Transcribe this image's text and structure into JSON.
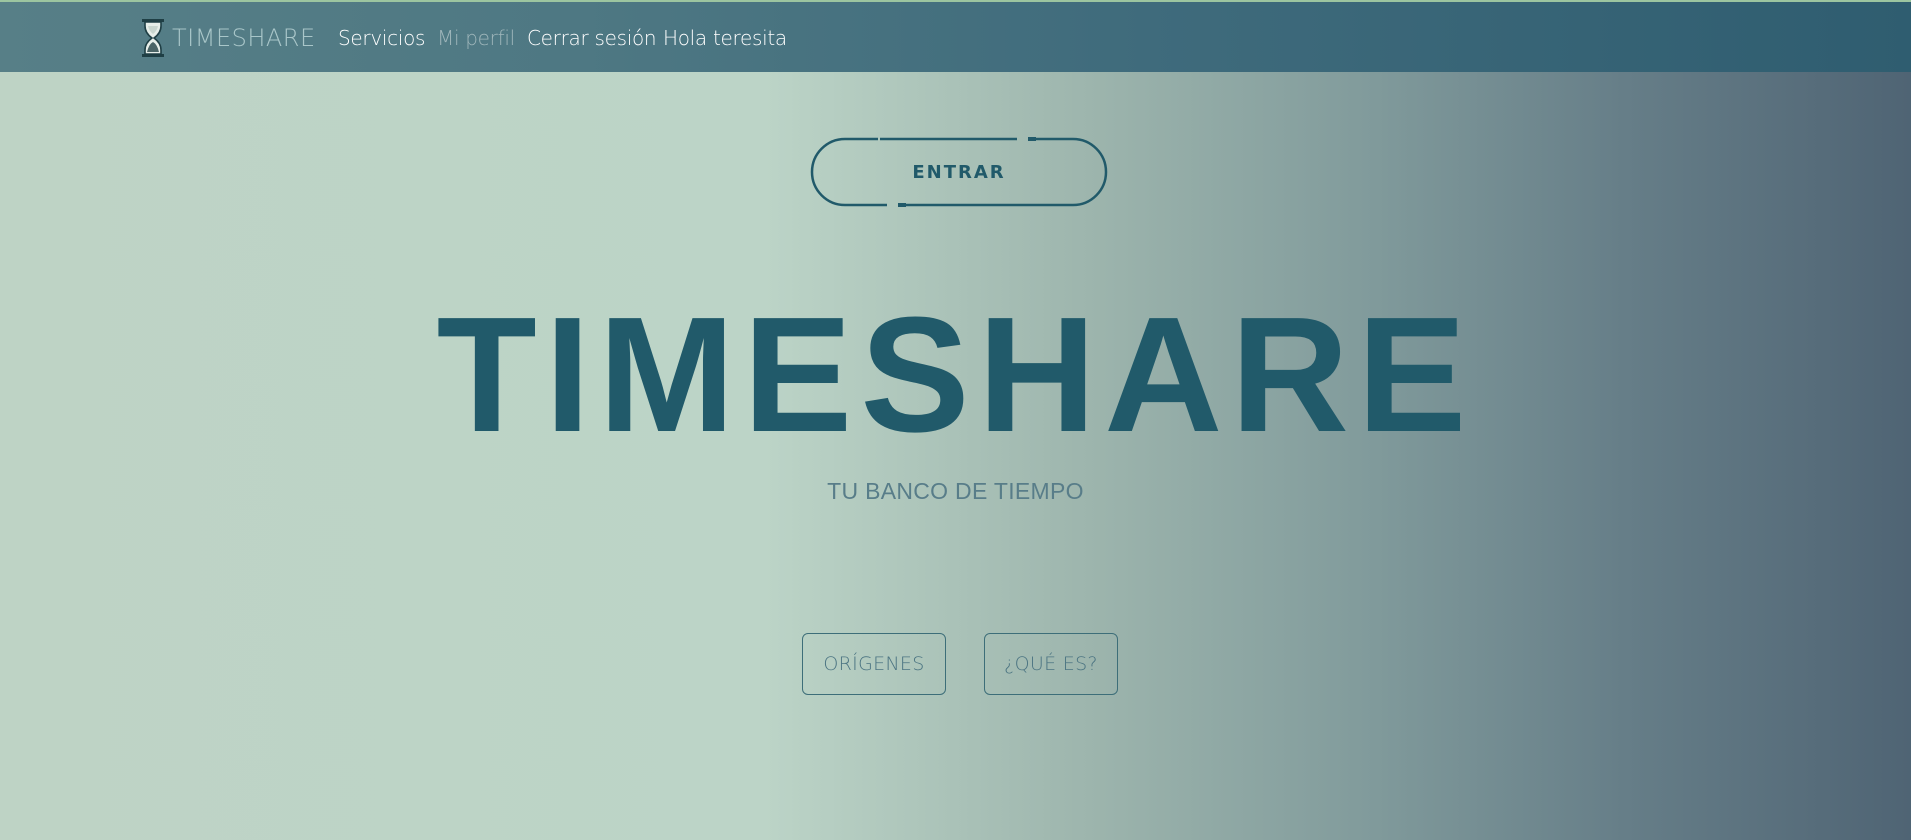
{
  "brand": {
    "name": "TIMESHARE",
    "logo_icon": "hourglass-icon"
  },
  "nav": {
    "items": [
      {
        "label": "Servicios",
        "state": "normal"
      },
      {
        "label": "Mi perfil",
        "state": "muted"
      },
      {
        "label": "Cerrar sesión",
        "state": "normal"
      },
      {
        "label": "Hola teresita",
        "state": "normal"
      }
    ]
  },
  "hero": {
    "enter_label": "ENTRAR",
    "title": "TIMESHARE",
    "subtitle": "TU BANCO DE TIEMPO"
  },
  "actions": {
    "origins_label": "ORÍGENES",
    "what_is_label": "¿QUÉ ES?"
  },
  "colors": {
    "primary": "#215a6a",
    "navbar": "#3f6b7c",
    "subtitle": "#587d89",
    "button_text": "#4b7482",
    "background_light": "#bed3c5",
    "background_dark": "#4f6474"
  }
}
